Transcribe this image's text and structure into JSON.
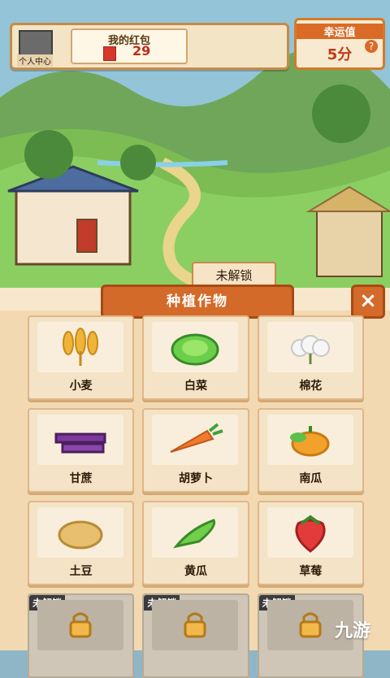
{
  "hud": {
    "avatar_label": "个人中心",
    "redpacket_title": "我的红包",
    "redpacket_count": "29",
    "lucky_title": "幸运值",
    "lucky_value": "5分",
    "help": "?"
  },
  "scene": {
    "unlock_label": "未解锁"
  },
  "panel": {
    "title": "种植作物",
    "close_label": "×"
  },
  "crops": [
    {
      "label": "小麦",
      "icon": "wheat-icon"
    },
    {
      "label": "白菜",
      "icon": "cabbage-icon"
    },
    {
      "label": "棉花",
      "icon": "cotton-icon"
    },
    {
      "label": "甘蔗",
      "icon": "sugarcane-icon"
    },
    {
      "label": "胡萝卜",
      "icon": "carrot-icon"
    },
    {
      "label": "南瓜",
      "icon": "pumpkin-icon"
    },
    {
      "label": "土豆",
      "icon": "potato-icon"
    },
    {
      "label": "黄瓜",
      "icon": "cucumber-icon"
    },
    {
      "label": "草莓",
      "icon": "strawberry-icon"
    }
  ],
  "locked": [
    {
      "tag": "未解锁",
      "icon": "lock-icon"
    },
    {
      "tag": "未解锁",
      "icon": "lock-icon"
    },
    {
      "tag": "未解锁",
      "icon": "lock-icon"
    }
  ],
  "watermark": "九游"
}
